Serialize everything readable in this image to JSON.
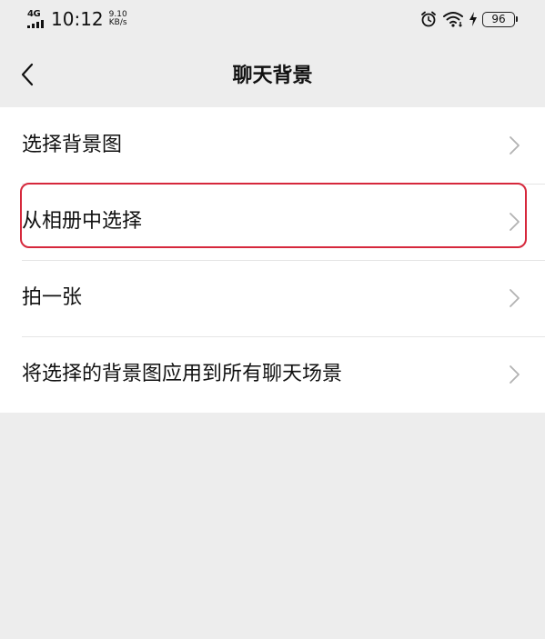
{
  "status_bar": {
    "network": "4G",
    "time": "10:12",
    "speed_value": "9.10",
    "speed_unit": "KB/s",
    "battery": "96",
    "icons": [
      "alarm-icon",
      "wifi-icon",
      "charging-icon",
      "battery-icon"
    ]
  },
  "nav": {
    "title": "聊天背景",
    "back_icon": "chevron-left-icon"
  },
  "list": {
    "items": [
      {
        "label": "选择背景图"
      },
      {
        "label": "从相册中选择",
        "highlighted": true
      },
      {
        "label": "拍一张"
      },
      {
        "label": "将选择的背景图应用到所有聊天场景"
      }
    ],
    "chevron_icon": "chevron-right-icon"
  },
  "colors": {
    "background": "#ededed",
    "list_background": "#ffffff",
    "highlight_border": "#d6283c",
    "chevron": "#b2b2b2",
    "divider": "#e5e5e5"
  }
}
